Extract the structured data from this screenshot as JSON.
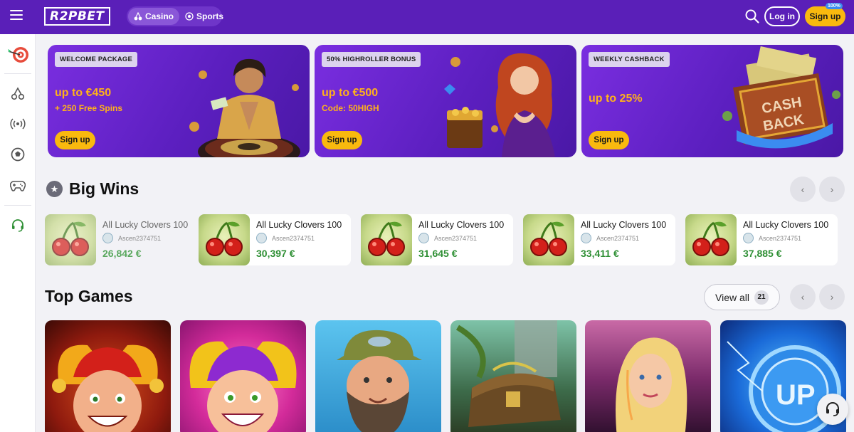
{
  "header": {
    "logo": "R2PBET",
    "modes": [
      {
        "label": "Casino",
        "icon": "cherries-icon",
        "active": true
      },
      {
        "label": "Sports",
        "icon": "soccer-ball-icon",
        "active": false
      }
    ],
    "login_label": "Log in",
    "signup_label": "Sign up",
    "signup_badge": "100%",
    "colors": {
      "bar": "#5a1fb8",
      "accent": "#f9b90e"
    }
  },
  "sidebar": {
    "items": [
      {
        "icon": "dartboard-icon"
      },
      {
        "icon": "cherries-icon"
      },
      {
        "icon": "live-broadcast-icon"
      },
      {
        "icon": "soccer-ball-icon"
      },
      {
        "icon": "gamepad-icon"
      },
      {
        "icon": "headset-icon"
      }
    ]
  },
  "promos": [
    {
      "tag": "WELCOME PACKAGE",
      "headline": "up to €450",
      "sub": "+ 250 Free Spins",
      "button": "Sign up"
    },
    {
      "tag": "50% HIGHROLLER BONUS",
      "headline": "up to €500",
      "sub": "Code: 50HIGH",
      "button": "Sign up"
    },
    {
      "tag": "WEEKLY CASHBACK",
      "headline": "up to 25%",
      "sub": "",
      "button": "Sign up",
      "art_text": [
        "CASH",
        "BACK"
      ]
    }
  ],
  "big_wins": {
    "title": "Big Wins",
    "items": [
      {
        "game": "All Lucky Clovers 100",
        "user": "Ascen2374751",
        "amount": "26,842 €"
      },
      {
        "game": "All Lucky Clovers 100",
        "user": "Ascen2374751",
        "amount": "30,397 €"
      },
      {
        "game": "All Lucky Clovers 100",
        "user": "Ascen2374751",
        "amount": "31,645 €"
      },
      {
        "game": "All Lucky Clovers 100",
        "user": "Ascen2374751",
        "amount": "33,411 €"
      },
      {
        "game": "All Lucky Clovers 100",
        "user": "Ascen2374751",
        "amount": "37,885 €"
      }
    ]
  },
  "top_games": {
    "title": "Top Games",
    "view_all_label": "View all",
    "view_all_count": "21",
    "tiles": [
      {
        "art": "red-jester"
      },
      {
        "art": "pink-jester"
      },
      {
        "art": "fisherman"
      },
      {
        "art": "treasure-chest"
      },
      {
        "art": "blonde-woman"
      },
      {
        "art": "up-coin",
        "art_text": "UP"
      }
    ]
  }
}
